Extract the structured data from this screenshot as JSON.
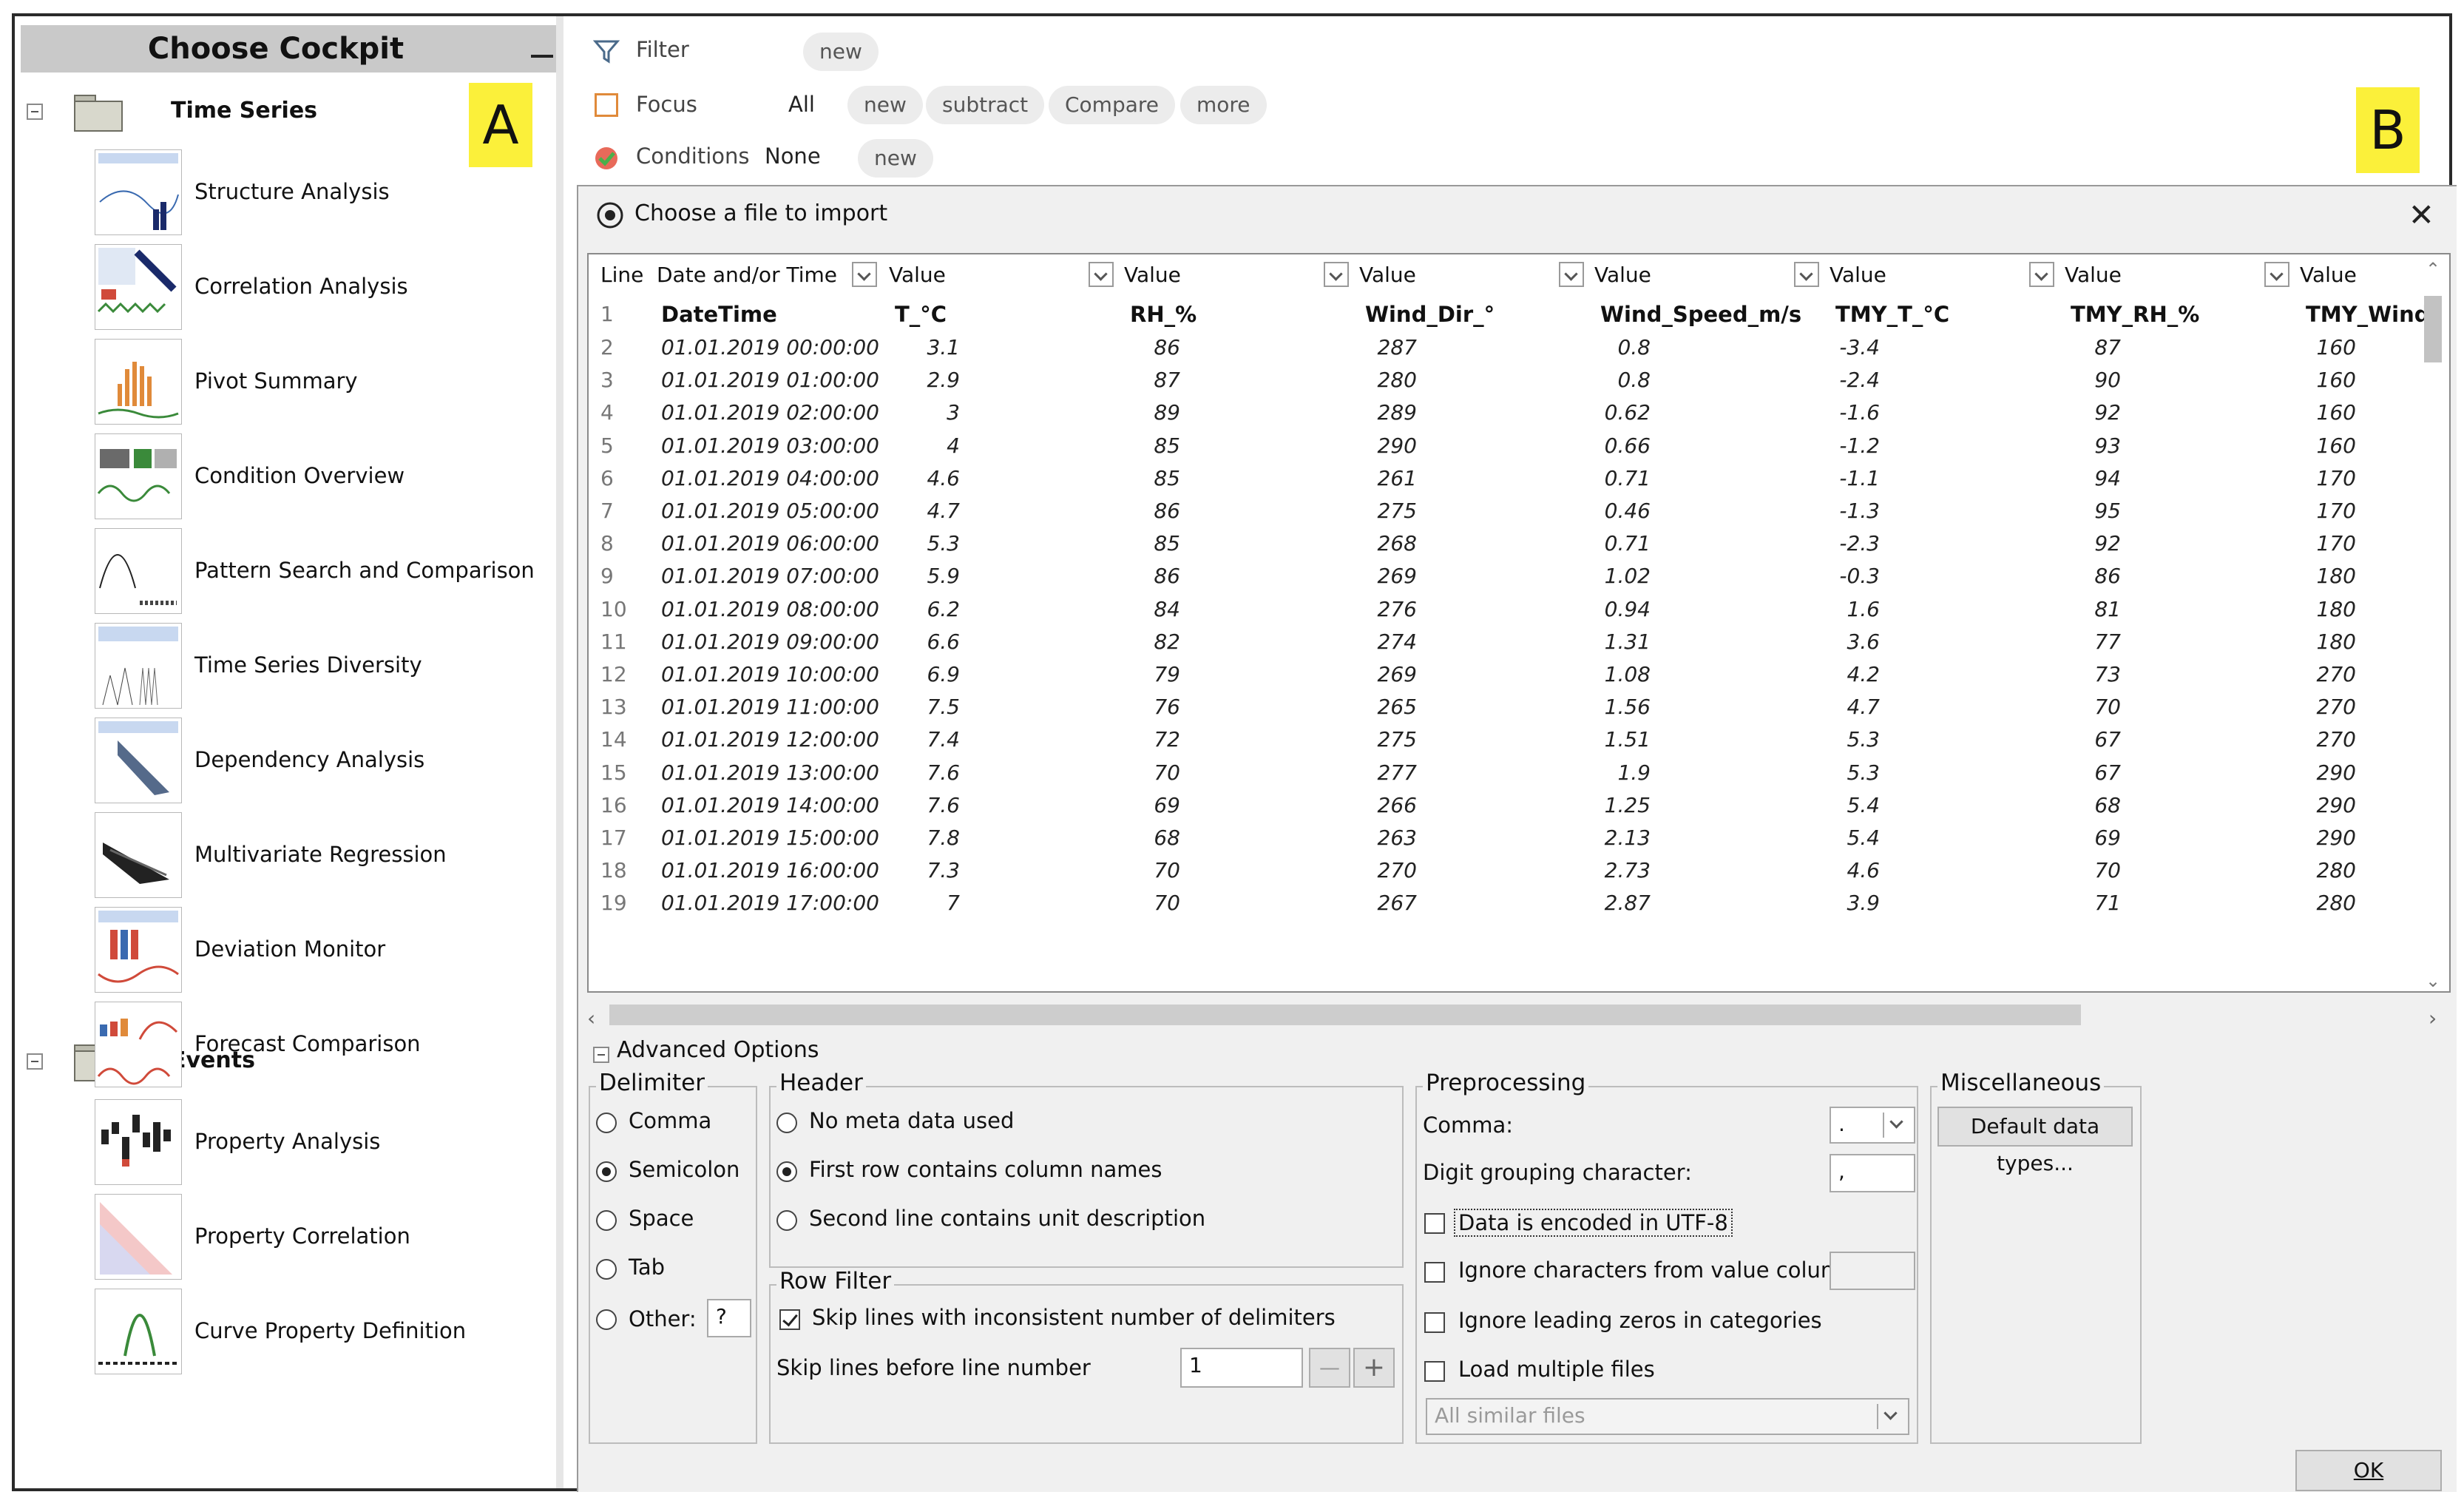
{
  "cockpit": {
    "title": "Choose Cockpit",
    "groups": [
      {
        "label": "Time Series",
        "items": [
          "Structure Analysis",
          "Correlation Analysis",
          "Pivot Summary",
          "Condition Overview",
          "Pattern Search and Comparison",
          "Time Series Diversity",
          "Dependency Analysis",
          "Multivariate Regression",
          "Deviation Monitor",
          "Forecast Comparison"
        ]
      },
      {
        "label": "Events",
        "items": [
          "Property Analysis",
          "Property Correlation",
          "Curve Property Definition"
        ]
      }
    ]
  },
  "badges": {
    "a": "A",
    "b": "B"
  },
  "filterbar": {
    "filter_label": "Filter",
    "filter_new": "new",
    "focus_label": "Focus",
    "focus_value": "All",
    "focus_new": "new",
    "focus_subtract": "subtract",
    "focus_compare": "Compare",
    "focus_more": "more",
    "conditions_label": "Conditions",
    "conditions_value": "None",
    "conditions_new": "new"
  },
  "dialog": {
    "title": "Choose a file to import",
    "columns": [
      "Line",
      "Date and/or Time",
      "Value",
      "Value",
      "Value",
      "Value",
      "Value",
      "Value",
      "Value"
    ],
    "header_row": {
      "line": "1",
      "cells": [
        "DateTime",
        "T_°C",
        "RH_%",
        "Wind_Dir_°",
        "Wind_Speed_m/s",
        "TMY_T_°C",
        "TMY_RH_%",
        "TMY_Wind"
      ]
    },
    "rows": [
      {
        "line": "2",
        "dt": "01.01.2019 00:00:00",
        "v": [
          "3.1",
          "86",
          "287",
          "0.8",
          "-3.4",
          "87",
          "160"
        ]
      },
      {
        "line": "3",
        "dt": "01.01.2019 01:00:00",
        "v": [
          "2.9",
          "87",
          "280",
          "0.8",
          "-2.4",
          "90",
          "160"
        ]
      },
      {
        "line": "4",
        "dt": "01.01.2019 02:00:00",
        "v": [
          "3",
          "89",
          "289",
          "0.62",
          "-1.6",
          "92",
          "160"
        ]
      },
      {
        "line": "5",
        "dt": "01.01.2019 03:00:00",
        "v": [
          "4",
          "85",
          "290",
          "0.66",
          "-1.2",
          "93",
          "160"
        ]
      },
      {
        "line": "6",
        "dt": "01.01.2019 04:00:00",
        "v": [
          "4.6",
          "85",
          "261",
          "0.71",
          "-1.1",
          "94",
          "170"
        ]
      },
      {
        "line": "7",
        "dt": "01.01.2019 05:00:00",
        "v": [
          "4.7",
          "86",
          "275",
          "0.46",
          "-1.3",
          "95",
          "170"
        ]
      },
      {
        "line": "8",
        "dt": "01.01.2019 06:00:00",
        "v": [
          "5.3",
          "85",
          "268",
          "0.71",
          "-2.3",
          "92",
          "170"
        ]
      },
      {
        "line": "9",
        "dt": "01.01.2019 07:00:00",
        "v": [
          "5.9",
          "86",
          "269",
          "1.02",
          "-0.3",
          "86",
          "180"
        ]
      },
      {
        "line": "10",
        "dt": "01.01.2019 08:00:00",
        "v": [
          "6.2",
          "84",
          "276",
          "0.94",
          "1.6",
          "81",
          "180"
        ]
      },
      {
        "line": "11",
        "dt": "01.01.2019 09:00:00",
        "v": [
          "6.6",
          "82",
          "274",
          "1.31",
          "3.6",
          "77",
          "180"
        ]
      },
      {
        "line": "12",
        "dt": "01.01.2019 10:00:00",
        "v": [
          "6.9",
          "79",
          "269",
          "1.08",
          "4.2",
          "73",
          "270"
        ]
      },
      {
        "line": "13",
        "dt": "01.01.2019 11:00:00",
        "v": [
          "7.5",
          "76",
          "265",
          "1.56",
          "4.7",
          "70",
          "270"
        ]
      },
      {
        "line": "14",
        "dt": "01.01.2019 12:00:00",
        "v": [
          "7.4",
          "72",
          "275",
          "1.51",
          "5.3",
          "67",
          "270"
        ]
      },
      {
        "line": "15",
        "dt": "01.01.2019 13:00:00",
        "v": [
          "7.6",
          "70",
          "277",
          "1.9",
          "5.3",
          "67",
          "290"
        ]
      },
      {
        "line": "16",
        "dt": "01.01.2019 14:00:00",
        "v": [
          "7.6",
          "69",
          "266",
          "1.25",
          "5.4",
          "68",
          "290"
        ]
      },
      {
        "line": "17",
        "dt": "01.01.2019 15:00:00",
        "v": [
          "7.8",
          "68",
          "263",
          "2.13",
          "5.4",
          "69",
          "290"
        ]
      },
      {
        "line": "18",
        "dt": "01.01.2019 16:00:00",
        "v": [
          "7.3",
          "70",
          "270",
          "2.73",
          "4.6",
          "70",
          "280"
        ]
      },
      {
        "line": "19",
        "dt": "01.01.2019 17:00:00",
        "v": [
          "7",
          "70",
          "267",
          "2.87",
          "3.9",
          "71",
          "280"
        ]
      }
    ],
    "advanced_label": "Advanced Options",
    "delimiter": {
      "legend": "Delimiter",
      "comma": "Comma",
      "semicolon": "Semicolon",
      "space": "Space",
      "tab": "Tab",
      "other": "Other:",
      "other_value": "?"
    },
    "header": {
      "legend": "Header",
      "opt1": "No meta data used",
      "opt2": "First row contains column names",
      "opt3": "Second line contains unit description"
    },
    "rowfilter": {
      "legend": "Row Filter",
      "skip_inconsistent": "Skip lines with inconsistent number of delimiters",
      "skip_before": "Skip lines before line number",
      "skip_value": "1"
    },
    "preprocessing": {
      "legend": "Preprocessing",
      "comma_label": "Comma:",
      "comma_value": ".",
      "digit_label": "Digit grouping character:",
      "digit_value": ",",
      "utf8": "Data is encoded in UTF-8",
      "ignore_chars": "Ignore characters from value columns",
      "ignore_zeros": "Ignore leading zeros in categories",
      "load_multiple": "Load multiple files",
      "similar": "All similar files"
    },
    "misc": {
      "legend": "Miscellaneous",
      "default_types": "Default data types..."
    },
    "ok": "OK"
  }
}
